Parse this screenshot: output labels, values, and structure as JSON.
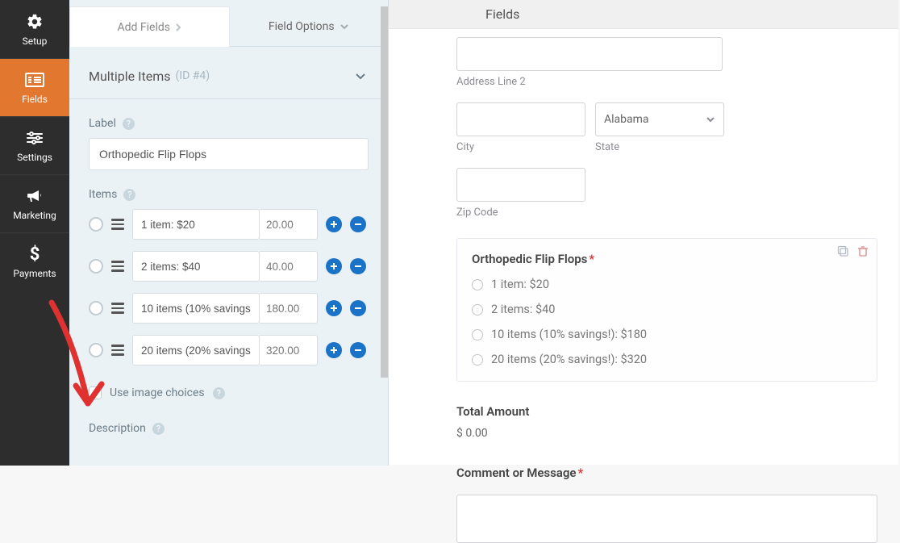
{
  "nav": {
    "setup": "Setup",
    "fields": "Fields",
    "settings": "Settings",
    "marketing": "Marketing",
    "payments": "Payments"
  },
  "tabs": {
    "add_fields": "Add Fields",
    "field_options": "Field Options"
  },
  "section": {
    "title": "Multiple Items",
    "id_text": "(ID #4)"
  },
  "labels": {
    "label": "Label",
    "items": "Items",
    "use_image_choices": "Use image choices",
    "description": "Description"
  },
  "label_value": "Orthopedic Flip Flops",
  "items": [
    {
      "label": "1 item: $20",
      "price": "20.00"
    },
    {
      "label": "2 items: $40",
      "price": "40.00"
    },
    {
      "label": "10 items (10% savings!): $180",
      "price": "180.00"
    },
    {
      "label": "20 items (20% savings!): $320",
      "price": "320.00"
    }
  ],
  "header": {
    "title": "Fields"
  },
  "preview": {
    "addr2": "Address Line 2",
    "city": "City",
    "state_label": "State",
    "state_value": "Alabama",
    "zip": "Zip Code",
    "card_title": "Orthopedic Flip Flops",
    "opts": [
      "1 item: $20",
      "2 items: $40",
      "10 items (10% savings!): $180",
      "20 items (20% savings!): $320"
    ],
    "total_label": "Total Amount",
    "total_value": "$ 0.00",
    "comment_label": "Comment or Message"
  }
}
